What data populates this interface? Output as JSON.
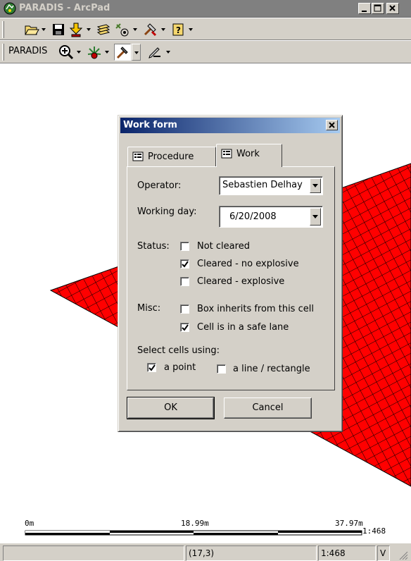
{
  "window": {
    "title": "PARADIS - ArcPad",
    "accent": "#808080"
  },
  "toolbar2": {
    "label": "PARADIS"
  },
  "map": {
    "fill_color": "#ff0000",
    "grid_color": "#000000",
    "scale": {
      "labels": [
        "0m",
        "18.99m",
        "37.97m"
      ],
      "ratio": "1:468"
    }
  },
  "statusbar": {
    "coords": "(17,3)",
    "scale": "1:468",
    "mode": "V"
  },
  "dialog": {
    "title": "Work form",
    "tabs": [
      {
        "label": "Procedure",
        "active": false
      },
      {
        "label": "Work",
        "active": true
      }
    ],
    "operator_label": "Operator:",
    "operator_value": "Sebastien Delhay",
    "working_day_label": "Working day:",
    "working_day_value": "6/20/2008",
    "status_label": "Status:",
    "status_options": [
      {
        "label": "Not cleared",
        "checked": false
      },
      {
        "label": "Cleared - no explosive",
        "checked": true
      },
      {
        "label": "Cleared - explosive",
        "checked": false
      }
    ],
    "misc_label": "Misc:",
    "misc_options": [
      {
        "label": "Box inherits from this cell",
        "checked": false
      },
      {
        "label": "Cell is in a safe lane",
        "checked": true
      }
    ],
    "select_label": "Select cells using:",
    "select_options": [
      {
        "label": "a point",
        "checked": true
      },
      {
        "label": "a line / rectangle",
        "checked": false
      }
    ],
    "ok_label": "OK",
    "cancel_label": "Cancel"
  }
}
